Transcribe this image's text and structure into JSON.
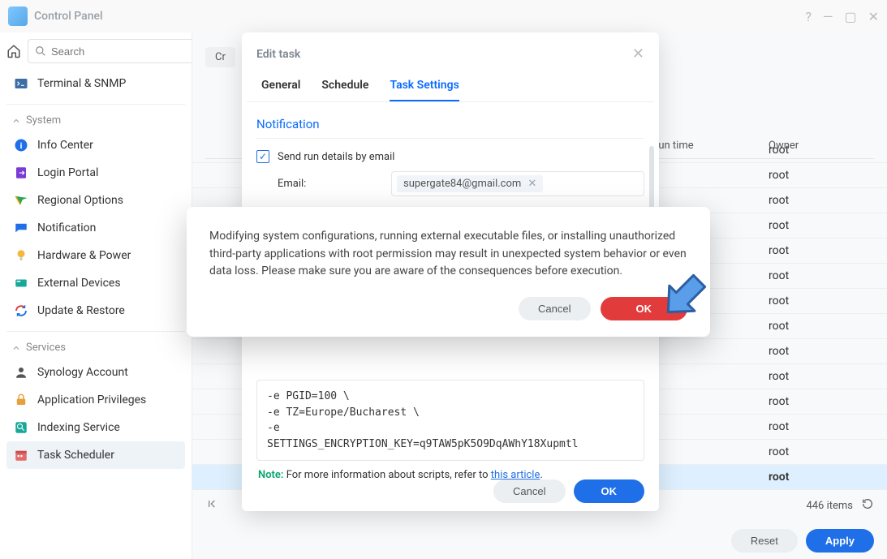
{
  "titlebar": {
    "title": "Control Panel"
  },
  "search": {
    "placeholder": "Search"
  },
  "sidebar": {
    "terminal": "Terminal & SNMP",
    "section_system": "System",
    "info_center": "Info Center",
    "login_portal": "Login Portal",
    "regional_options": "Regional Options",
    "notification": "Notification",
    "hardware_power": "Hardware & Power",
    "external_devices": "External Devices",
    "update_restore": "Update & Restore",
    "section_services": "Services",
    "synology_account": "Synology Account",
    "application_privileges": "Application Privileges",
    "indexing_service": "Indexing Service",
    "task_scheduler": "Task Scheduler"
  },
  "toolbar": {
    "create": "Cr"
  },
  "headers": {
    "next_run_time": "xt run time",
    "owner": "Owner"
  },
  "owners": [
    "root",
    "root",
    "root",
    "root",
    "root",
    "root",
    "root",
    "root",
    "root",
    "root",
    "root",
    "root",
    "root",
    "root"
  ],
  "footer": {
    "items_count": "446 items",
    "reset": "Reset",
    "apply": "Apply"
  },
  "edit_modal": {
    "title": "Edit task",
    "tabs": {
      "general": "General",
      "schedule": "Schedule",
      "task_settings": "Task Settings"
    },
    "section_notification": "Notification",
    "send_run_details": "Send run details by email",
    "email_label": "Email:",
    "email_value": "supergate84@gmail.com",
    "script_text": "-e PGID=100 \\\n-e TZ=Europe/Bucharest \\\n-e\nSETTINGS_ENCRYPTION_KEY=q9TAW5pK5O9DqAWhY18Xupmtl",
    "note_label": "Note:",
    "note_text": " For more information about scripts, refer to ",
    "note_link": "this article",
    "cancel": "Cancel",
    "ok": "OK"
  },
  "warn_modal": {
    "text": "Modifying system configurations, running external executable files, or installing unauthorized third-party applications with root permission may result in unexpected system behavior or even data loss. Please make sure you are aware of the consequences before execution.",
    "cancel": "Cancel",
    "ok": "OK"
  }
}
